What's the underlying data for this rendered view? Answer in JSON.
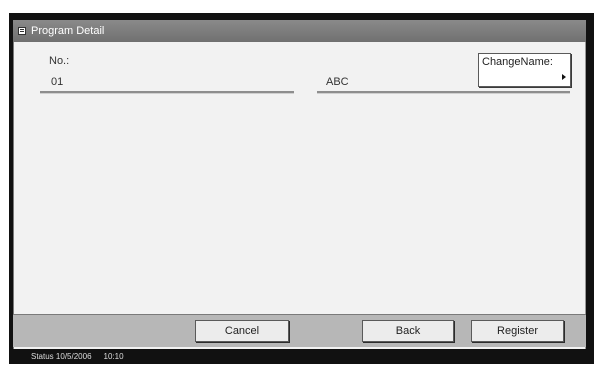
{
  "window": {
    "title": "Program Detail",
    "title_icon": "program-icon"
  },
  "fields": {
    "number_label": "No.:",
    "number_value": "01",
    "name_value": "ABC"
  },
  "change_name": {
    "label": "ChangeName:",
    "icon": "arrow-right-icon"
  },
  "buttons": {
    "cancel": "Cancel",
    "back": "Back",
    "register": "Register"
  },
  "status": {
    "label": "Status",
    "date": "10/5/2006",
    "time": "10:10"
  },
  "colors": {
    "title_bar": "#7a7a7a",
    "panel": "#f2f2f2",
    "bottom_bar": "#b7b7b7",
    "frame": "#111111"
  }
}
